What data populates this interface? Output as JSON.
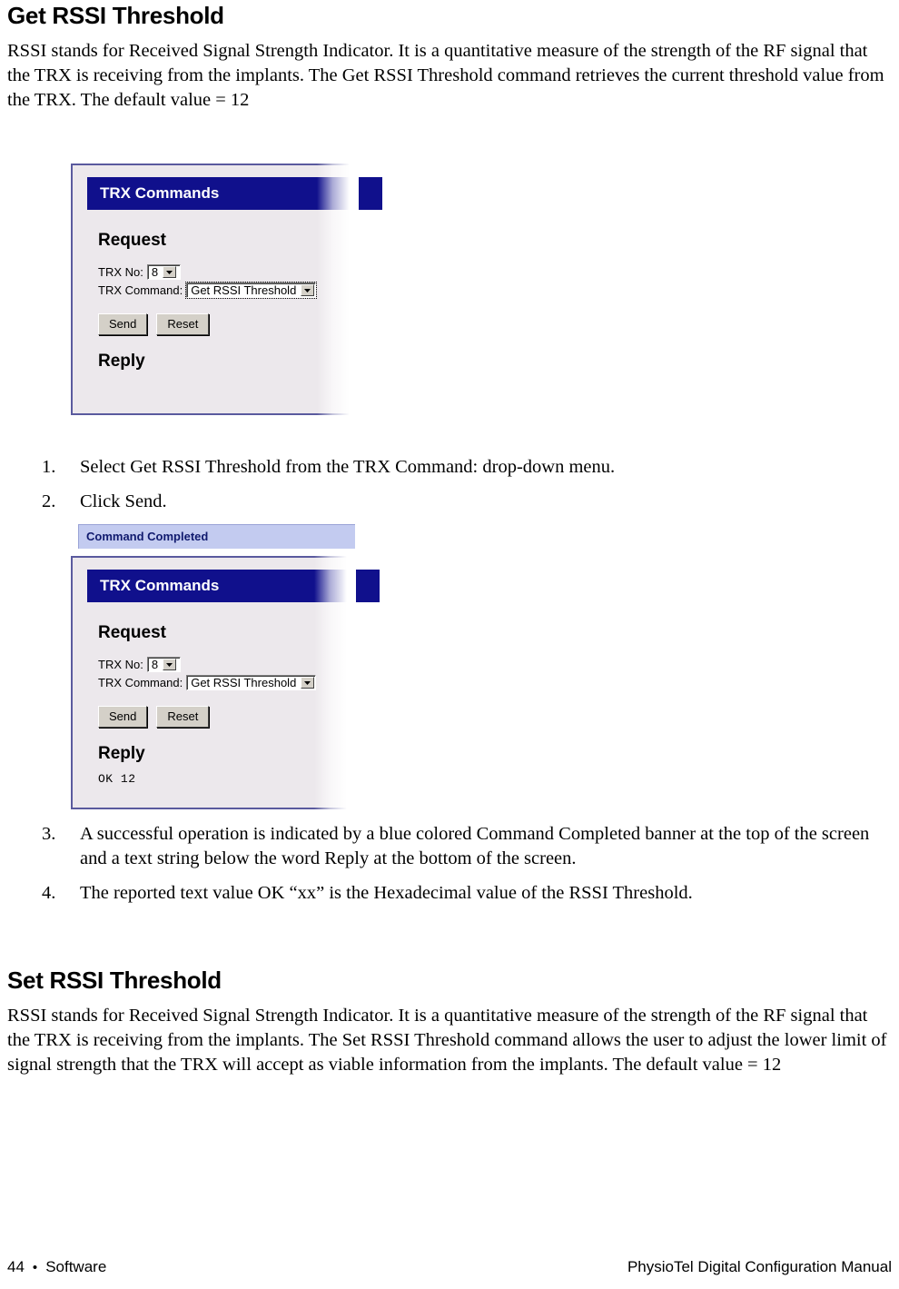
{
  "section1": {
    "heading": "Get RSSI Threshold",
    "paragraph": "RSSI stands for Received Signal Strength Indicator. It is a quantitative measure of the strength of the RF signal that the TRX is receiving from the implants.  The Get RSSI Threshold command retrieves the current threshold value from the TRX. The default value = 12"
  },
  "screenshot1": {
    "titlebar": "TRX Commands",
    "request_heading": "Request",
    "trx_no_label": "TRX No:",
    "trx_no_value": "8",
    "trx_command_label": "TRX Command:",
    "trx_command_value": "Get RSSI Threshold",
    "send_label": "Send",
    "reset_label": "Reset",
    "reply_heading": "Reply",
    "reply_text": ""
  },
  "steps_a": [
    {
      "num": "1.",
      "text": "Select Get RSSI Threshold from the TRX Command: drop-down menu."
    },
    {
      "num": "2.",
      "text": "Click Send."
    }
  ],
  "screenshot2": {
    "status_banner": "Command Completed",
    "titlebar": "TRX Commands",
    "request_heading": "Request",
    "trx_no_label": "TRX No:",
    "trx_no_value": "8",
    "trx_command_label": "TRX Command:",
    "trx_command_value": "Get RSSI Threshold",
    "send_label": "Send",
    "reset_label": "Reset",
    "reply_heading": "Reply",
    "reply_text": "OK 12"
  },
  "steps_b": [
    {
      "num": "3.",
      "text": "A successful operation is indicated by a blue colored Command Completed banner at the top of the screen and a text string below the word Reply at the bottom of the screen."
    },
    {
      "num": "4.",
      "text": "The reported text value OK “xx” is the Hexadecimal value of the RSSI Threshold."
    }
  ],
  "section2": {
    "heading": "Set RSSI Threshold",
    "paragraph": "RSSI stands for Received Signal Strength Indicator. It is a quantitative measure of the strength of the RF signal that the TRX is receiving from the implants.  The Set RSSI Threshold command allows the user to adjust the lower limit of signal strength that the TRX will accept as viable information from the implants. The default value = 12"
  },
  "footer": {
    "page_number": "44",
    "bullet": "•",
    "section_name": "Software",
    "manual_title": "PhysioTel Digital Configuration Manual"
  },
  "colors": {
    "titlebar_navy": "#10108c",
    "panel_bg": "#ece8ec",
    "panel_border": "#5a5a9e",
    "banner_bg": "#c3cbf0",
    "banner_text": "#101a6e",
    "button_face": "#d4d0c8"
  }
}
